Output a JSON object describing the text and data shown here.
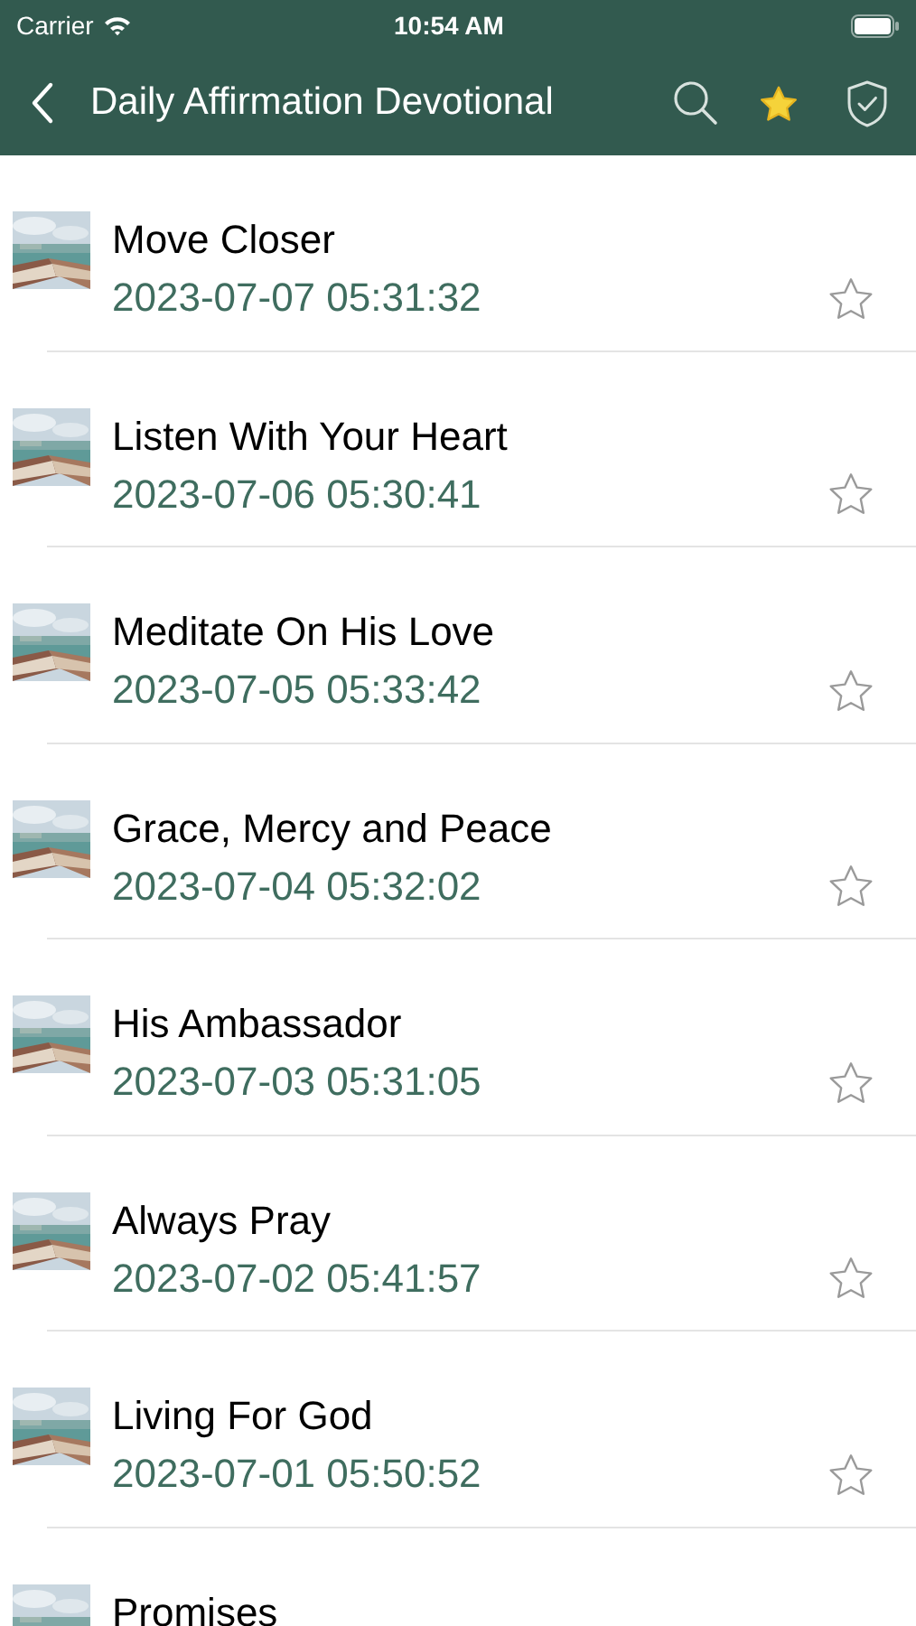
{
  "status_bar": {
    "carrier": "Carrier",
    "time": "10:54 AM"
  },
  "nav_bar": {
    "title": "Daily Affirmation Devotional",
    "favorites_active": true
  },
  "entries": [
    {
      "title": "Move Closer",
      "date": "2023-07-07 05:31:32",
      "starred": false
    },
    {
      "title": "Listen With Your Heart",
      "date": "2023-07-06 05:30:41",
      "starred": false
    },
    {
      "title": "Meditate On His Love",
      "date": "2023-07-05 05:33:42",
      "starred": false
    },
    {
      "title": "Grace, Mercy and Peace",
      "date": "2023-07-04 05:32:02",
      "starred": false
    },
    {
      "title": "His Ambassador",
      "date": "2023-07-03 05:31:05",
      "starred": false
    },
    {
      "title": "Always Pray",
      "date": "2023-07-02 05:41:57",
      "starred": false
    },
    {
      "title": "Living For God",
      "date": "2023-07-01 05:50:52",
      "starred": false
    },
    {
      "title": "Promises"
    }
  ]
}
